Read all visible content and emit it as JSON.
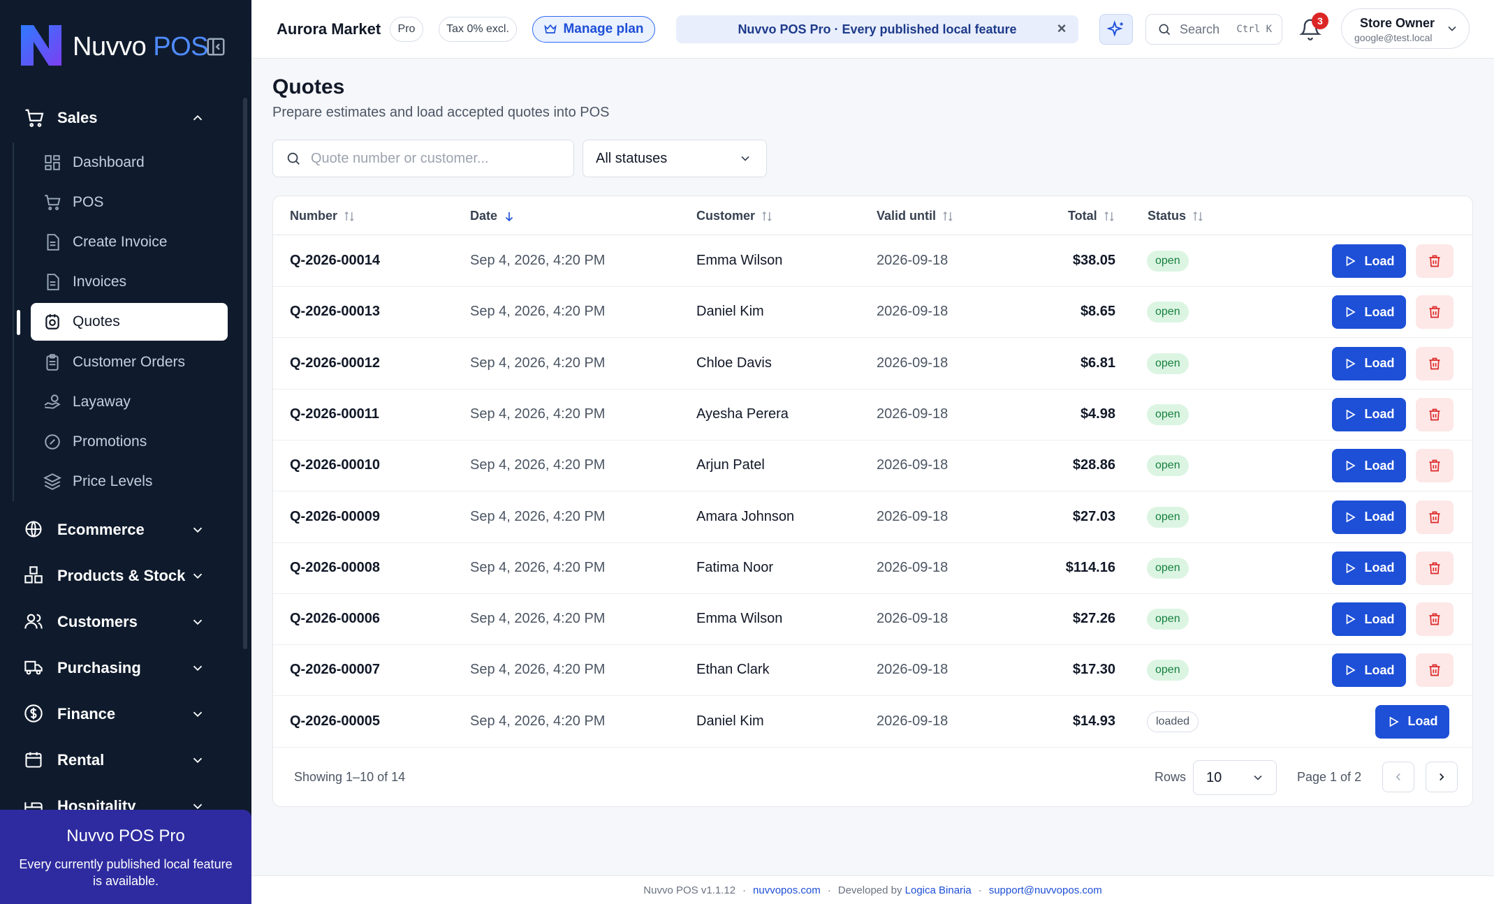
{
  "brand": {
    "name_part1": "Nuvvo",
    "name_part2": "POS"
  },
  "sidebar": {
    "sections": [
      {
        "label": "Sales",
        "icon": "cart-icon",
        "expanded": true
      },
      {
        "label": "Ecommerce",
        "icon": "globe-icon"
      },
      {
        "label": "Products & Stock",
        "icon": "boxes-icon"
      },
      {
        "label": "Customers",
        "icon": "users-icon"
      },
      {
        "label": "Purchasing",
        "icon": "truck-icon"
      },
      {
        "label": "Finance",
        "icon": "dollar-icon"
      },
      {
        "label": "Rental",
        "icon": "calendar-icon"
      },
      {
        "label": "Hospitality",
        "icon": "bed-icon"
      }
    ],
    "sales_items": [
      {
        "label": "Dashboard",
        "icon": "dashboard-icon"
      },
      {
        "label": "POS",
        "icon": "cart-icon"
      },
      {
        "label": "Create Invoice",
        "icon": "document-icon"
      },
      {
        "label": "Invoices",
        "icon": "document-icon"
      },
      {
        "label": "Quotes",
        "icon": "quote-icon",
        "active": true
      },
      {
        "label": "Customer Orders",
        "icon": "clipboard-icon"
      },
      {
        "label": "Layaway",
        "icon": "hand-coins-icon"
      },
      {
        "label": "Promotions",
        "icon": "badge-percent-icon"
      },
      {
        "label": "Price Levels",
        "icon": "layers-icon"
      }
    ],
    "promo": {
      "title": "Nuvvo POS Pro",
      "description": "Every currently published local feature is available."
    }
  },
  "topbar": {
    "store_name": "Aurora Market",
    "plan_badge": "Pro",
    "tax_badge": "Tax 0% excl.",
    "manage_plan": "Manage plan",
    "banner": "Nuvvo POS Pro · Every published local feature",
    "search_label": "Search",
    "search_shortcut": "Ctrl K",
    "notification_count": "3",
    "user_name": "Store Owner",
    "user_email": "google@test.local"
  },
  "page": {
    "title": "Quotes",
    "subtitle": "Prepare estimates and load accepted quotes into POS",
    "search_placeholder": "Quote number or customer...",
    "status_filter": "All statuses"
  },
  "table": {
    "headers": {
      "number": "Number",
      "date": "Date",
      "customer": "Customer",
      "valid_until": "Valid until",
      "total": "Total",
      "status": "Status"
    },
    "load_label": "Load",
    "rows": [
      {
        "number": "Q-2026-00014",
        "date": "Sep 4, 2026, 4:20 PM",
        "customer": "Emma Wilson",
        "valid_until": "2026-09-18",
        "total": "$38.05",
        "status": "open"
      },
      {
        "number": "Q-2026-00013",
        "date": "Sep 4, 2026, 4:20 PM",
        "customer": "Daniel Kim",
        "valid_until": "2026-09-18",
        "total": "$8.65",
        "status": "open"
      },
      {
        "number": "Q-2026-00012",
        "date": "Sep 4, 2026, 4:20 PM",
        "customer": "Chloe Davis",
        "valid_until": "2026-09-18",
        "total": "$6.81",
        "status": "open"
      },
      {
        "number": "Q-2026-00011",
        "date": "Sep 4, 2026, 4:20 PM",
        "customer": "Ayesha Perera",
        "valid_until": "2026-09-18",
        "total": "$4.98",
        "status": "open"
      },
      {
        "number": "Q-2026-00010",
        "date": "Sep 4, 2026, 4:20 PM",
        "customer": "Arjun Patel",
        "valid_until": "2026-09-18",
        "total": "$28.86",
        "status": "open"
      },
      {
        "number": "Q-2026-00009",
        "date": "Sep 4, 2026, 4:20 PM",
        "customer": "Amara Johnson",
        "valid_until": "2026-09-18",
        "total": "$27.03",
        "status": "open"
      },
      {
        "number": "Q-2026-00008",
        "date": "Sep 4, 2026, 4:20 PM",
        "customer": "Fatima Noor",
        "valid_until": "2026-09-18",
        "total": "$114.16",
        "status": "open"
      },
      {
        "number": "Q-2026-00006",
        "date": "Sep 4, 2026, 4:20 PM",
        "customer": "Emma Wilson",
        "valid_until": "2026-09-18",
        "total": "$27.26",
        "status": "open"
      },
      {
        "number": "Q-2026-00007",
        "date": "Sep 4, 2026, 4:20 PM",
        "customer": "Ethan Clark",
        "valid_until": "2026-09-18",
        "total": "$17.30",
        "status": "open"
      },
      {
        "number": "Q-2026-00005",
        "date": "Sep 4, 2026, 4:20 PM",
        "customer": "Daniel Kim",
        "valid_until": "2026-09-18",
        "total": "$14.93",
        "status": "loaded"
      }
    ],
    "showing": "Showing 1–10 of 14",
    "rows_label": "Rows",
    "rows_per_page": "10",
    "page_info": "Page 1 of 2"
  },
  "footer": {
    "version": "Nuvvo POS v1.1.12",
    "site": "nuvvopos.com",
    "developed_by": "Developed by",
    "developer": "Logica Binaria",
    "email": "support@nuvvopos.com",
    "separator": "·"
  },
  "colors": {
    "sidebar_bg": "#0f1b2d",
    "accent": "#1d4fd7",
    "promo_bg": "#2e2ba0",
    "open_badge": "#dcf5e3",
    "delete_bg": "#fde7e7"
  }
}
